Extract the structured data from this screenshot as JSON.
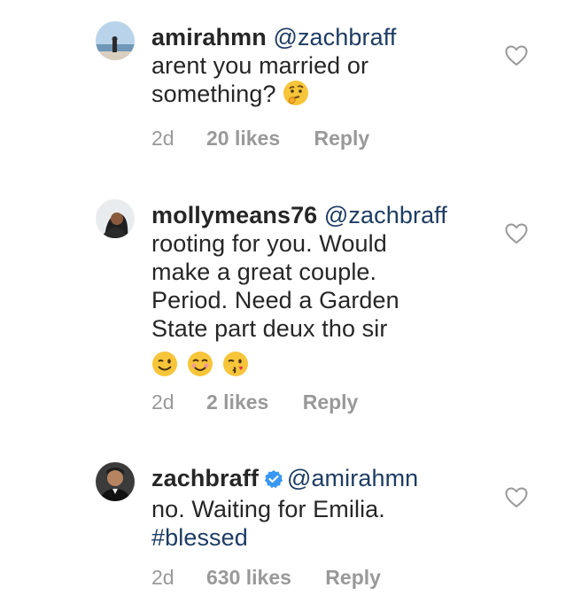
{
  "comments": [
    {
      "username": "amirahmn",
      "verified": false,
      "mention": "@zachbraff",
      "text_lines": [
        "arent you married or",
        "something? "
      ],
      "emoji_icons": [
        "thinking-face-icon"
      ],
      "age": "2d",
      "likes": "20 likes",
      "reply": "Reply"
    },
    {
      "username": "mollymeans76",
      "verified": false,
      "mention": "@zachbraff",
      "text_lines": [
        "rooting for you. Would",
        "make a great couple.",
        "Period. Need a Garden",
        "State part deux tho sir"
      ],
      "emoji_icons": [
        "winking-face-icon",
        "smiling-face-icon",
        "kissing-face-icon"
      ],
      "age": "2d",
      "likes": "2 likes",
      "reply": "Reply"
    },
    {
      "username": "zachbraff",
      "verified": true,
      "mention": "@amirahmn",
      "text_lines": [
        "no. Waiting for Emilia."
      ],
      "hashtag": "#blessed",
      "age": "2d",
      "likes": "630 likes",
      "reply": "Reply"
    }
  ],
  "colors": {
    "text": "#262626",
    "mention": "#1d3c63",
    "meta": "#999999",
    "verified_badge": "#3897f0"
  }
}
